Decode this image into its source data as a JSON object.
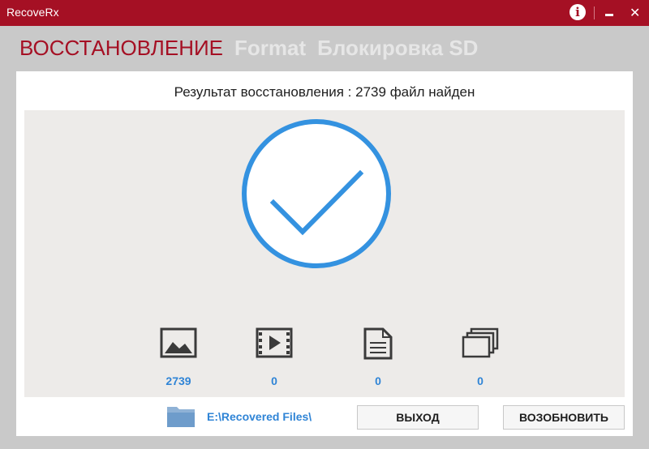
{
  "window": {
    "title": "RecoveRx",
    "controls": {
      "info_icon": "info-icon",
      "minimize_icon": "minimize-icon",
      "close_icon": "close-icon",
      "info_glyph": "i",
      "close_glyph": "✕"
    }
  },
  "tabs": [
    {
      "label": "ВОССТАНОВЛЕНИЕ",
      "active": true
    },
    {
      "label": "Format",
      "active": false
    },
    {
      "label": "Блокировка SD",
      "active": false
    }
  ],
  "result": {
    "prefix": "Результат восстановления",
    "separator": " : ",
    "count": "2739",
    "suffix": "файл найден"
  },
  "status_icon": "checkmark-circle-icon",
  "categories": [
    {
      "icon": "image-icon",
      "count": "2739"
    },
    {
      "icon": "video-icon",
      "count": "0"
    },
    {
      "icon": "document-icon",
      "count": "0"
    },
    {
      "icon": "other-files-icon",
      "count": "0"
    }
  ],
  "output": {
    "icon": "folder-icon",
    "path": "E:\\Recovered Files\\"
  },
  "buttons": {
    "exit": "ВЫХОД",
    "restart": "ВОЗОБНОВИТЬ"
  },
  "colors": {
    "brand": "#a51024",
    "accent_blue": "#2f84d6",
    "check_blue": "#3492e0",
    "icon_dark": "#3a3a3a"
  }
}
